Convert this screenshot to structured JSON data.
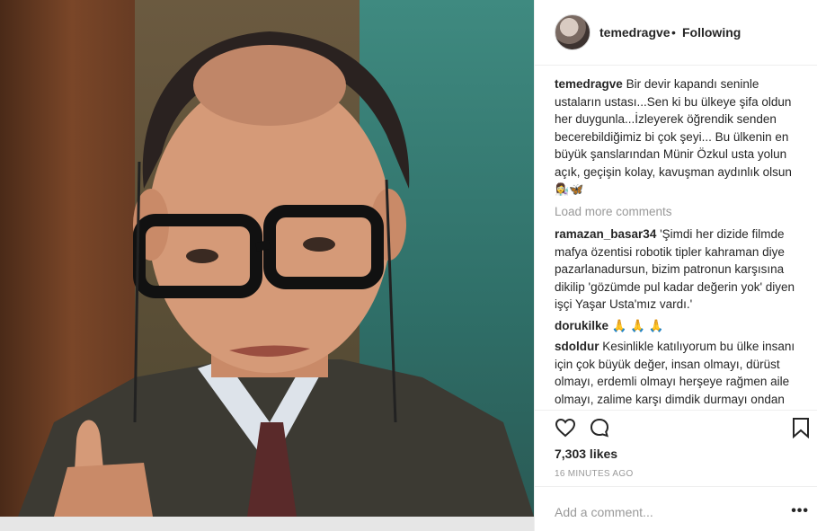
{
  "post": {
    "username": "temedragve",
    "separator": "•",
    "follow_status": "Following"
  },
  "caption": {
    "user": "temedragve",
    "text": "Bir devir kapandı seninle ustaların ustası...Sen ki bu ülkeye şifa oldun her duygunla...İzleyerek öğrendik senden becerebildiğimiz bi çok şeyi... Bu ülkenin en büyük şanslarından Münir Özkul usta yolun açık, geçişin kolay, kavuşman aydınlık olsun",
    "emoji": "👩‍🔬🦋"
  },
  "load_more": "Load more comments",
  "comments": [
    {
      "user": "ramazan_basar34",
      "text": "'Şimdi her dizide filmde mafya özentisi robotik tipler kahraman diye pazarlanadursun, bizim patronun karşısına dikilip 'gözümde pul kadar değerin yok' diyen işçi Yaşar Usta'mız vardı.'"
    },
    {
      "user": "dorukilke",
      "text": "🙏 🙏 🙏"
    },
    {
      "user": "sdoldur",
      "text": "Kesinlikle katılıyorum bu ülke insanı için çok büyük değer, insan olmayı, dürüst olmayı, erdemli olmayı herşeye rağmen aile olmayı, zalime karşı dimdik durmayı ondan öğrendik ışıklar içinde uyu"
    }
  ],
  "likes": "7,303 likes",
  "timestamp": "16 MINUTES AGO",
  "add_comment_placeholder": "Add a comment...",
  "more_label": "•••",
  "icons": {
    "like": "heart-icon",
    "comment": "comment-icon",
    "save": "bookmark-icon"
  }
}
